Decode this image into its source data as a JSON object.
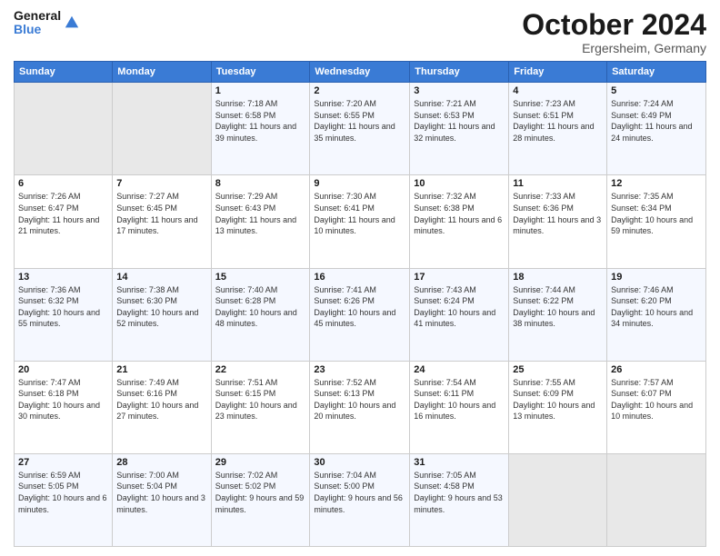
{
  "header": {
    "logo_line1": "General",
    "logo_line2": "Blue",
    "month": "October 2024",
    "location": "Ergersheim, Germany"
  },
  "weekdays": [
    "Sunday",
    "Monday",
    "Tuesday",
    "Wednesday",
    "Thursday",
    "Friday",
    "Saturday"
  ],
  "weeks": [
    [
      {
        "day": "",
        "detail": ""
      },
      {
        "day": "",
        "detail": ""
      },
      {
        "day": "1",
        "detail": "Sunrise: 7:18 AM\nSunset: 6:58 PM\nDaylight: 11 hours and 39 minutes."
      },
      {
        "day": "2",
        "detail": "Sunrise: 7:20 AM\nSunset: 6:55 PM\nDaylight: 11 hours and 35 minutes."
      },
      {
        "day": "3",
        "detail": "Sunrise: 7:21 AM\nSunset: 6:53 PM\nDaylight: 11 hours and 32 minutes."
      },
      {
        "day": "4",
        "detail": "Sunrise: 7:23 AM\nSunset: 6:51 PM\nDaylight: 11 hours and 28 minutes."
      },
      {
        "day": "5",
        "detail": "Sunrise: 7:24 AM\nSunset: 6:49 PM\nDaylight: 11 hours and 24 minutes."
      }
    ],
    [
      {
        "day": "6",
        "detail": "Sunrise: 7:26 AM\nSunset: 6:47 PM\nDaylight: 11 hours and 21 minutes."
      },
      {
        "day": "7",
        "detail": "Sunrise: 7:27 AM\nSunset: 6:45 PM\nDaylight: 11 hours and 17 minutes."
      },
      {
        "day": "8",
        "detail": "Sunrise: 7:29 AM\nSunset: 6:43 PM\nDaylight: 11 hours and 13 minutes."
      },
      {
        "day": "9",
        "detail": "Sunrise: 7:30 AM\nSunset: 6:41 PM\nDaylight: 11 hours and 10 minutes."
      },
      {
        "day": "10",
        "detail": "Sunrise: 7:32 AM\nSunset: 6:38 PM\nDaylight: 11 hours and 6 minutes."
      },
      {
        "day": "11",
        "detail": "Sunrise: 7:33 AM\nSunset: 6:36 PM\nDaylight: 11 hours and 3 minutes."
      },
      {
        "day": "12",
        "detail": "Sunrise: 7:35 AM\nSunset: 6:34 PM\nDaylight: 10 hours and 59 minutes."
      }
    ],
    [
      {
        "day": "13",
        "detail": "Sunrise: 7:36 AM\nSunset: 6:32 PM\nDaylight: 10 hours and 55 minutes."
      },
      {
        "day": "14",
        "detail": "Sunrise: 7:38 AM\nSunset: 6:30 PM\nDaylight: 10 hours and 52 minutes."
      },
      {
        "day": "15",
        "detail": "Sunrise: 7:40 AM\nSunset: 6:28 PM\nDaylight: 10 hours and 48 minutes."
      },
      {
        "day": "16",
        "detail": "Sunrise: 7:41 AM\nSunset: 6:26 PM\nDaylight: 10 hours and 45 minutes."
      },
      {
        "day": "17",
        "detail": "Sunrise: 7:43 AM\nSunset: 6:24 PM\nDaylight: 10 hours and 41 minutes."
      },
      {
        "day": "18",
        "detail": "Sunrise: 7:44 AM\nSunset: 6:22 PM\nDaylight: 10 hours and 38 minutes."
      },
      {
        "day": "19",
        "detail": "Sunrise: 7:46 AM\nSunset: 6:20 PM\nDaylight: 10 hours and 34 minutes."
      }
    ],
    [
      {
        "day": "20",
        "detail": "Sunrise: 7:47 AM\nSunset: 6:18 PM\nDaylight: 10 hours and 30 minutes."
      },
      {
        "day": "21",
        "detail": "Sunrise: 7:49 AM\nSunset: 6:16 PM\nDaylight: 10 hours and 27 minutes."
      },
      {
        "day": "22",
        "detail": "Sunrise: 7:51 AM\nSunset: 6:15 PM\nDaylight: 10 hours and 23 minutes."
      },
      {
        "day": "23",
        "detail": "Sunrise: 7:52 AM\nSunset: 6:13 PM\nDaylight: 10 hours and 20 minutes."
      },
      {
        "day": "24",
        "detail": "Sunrise: 7:54 AM\nSunset: 6:11 PM\nDaylight: 10 hours and 16 minutes."
      },
      {
        "day": "25",
        "detail": "Sunrise: 7:55 AM\nSunset: 6:09 PM\nDaylight: 10 hours and 13 minutes."
      },
      {
        "day": "26",
        "detail": "Sunrise: 7:57 AM\nSunset: 6:07 PM\nDaylight: 10 hours and 10 minutes."
      }
    ],
    [
      {
        "day": "27",
        "detail": "Sunrise: 6:59 AM\nSunset: 5:05 PM\nDaylight: 10 hours and 6 minutes."
      },
      {
        "day": "28",
        "detail": "Sunrise: 7:00 AM\nSunset: 5:04 PM\nDaylight: 10 hours and 3 minutes."
      },
      {
        "day": "29",
        "detail": "Sunrise: 7:02 AM\nSunset: 5:02 PM\nDaylight: 9 hours and 59 minutes."
      },
      {
        "day": "30",
        "detail": "Sunrise: 7:04 AM\nSunset: 5:00 PM\nDaylight: 9 hours and 56 minutes."
      },
      {
        "day": "31",
        "detail": "Sunrise: 7:05 AM\nSunset: 4:58 PM\nDaylight: 9 hours and 53 minutes."
      },
      {
        "day": "",
        "detail": ""
      },
      {
        "day": "",
        "detail": ""
      }
    ]
  ]
}
